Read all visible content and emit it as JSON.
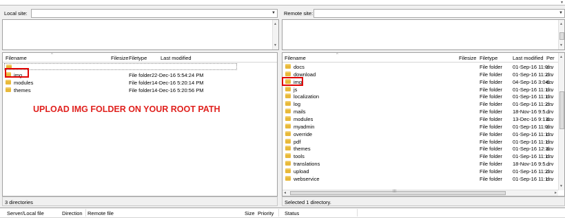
{
  "local": {
    "site_label": "Local site:",
    "headers": {
      "name": "Filename",
      "size": "Filesize",
      "type": "Filetype",
      "modified": "Last modified"
    },
    "rows": [
      {
        "name": "..",
        "type": "",
        "modified": ""
      },
      {
        "name": "img",
        "type": "File folder",
        "modified": "22-Dec-16 5:54:24 PM"
      },
      {
        "name": "modules",
        "type": "File folder",
        "modified": "14-Dec-16 5:20:14 PM"
      },
      {
        "name": "themes",
        "type": "File folder",
        "modified": "14-Dec-16 5:20:56 PM"
      }
    ],
    "status": "3 directories"
  },
  "remote": {
    "site_label": "Remote site:",
    "headers": {
      "name": "Filename",
      "size": "Filesize",
      "type": "Filetype",
      "modified": "Last modified",
      "perm": "Per"
    },
    "rows": [
      {
        "name": "docs",
        "type": "File folder",
        "modified": "01-Sep-16 11:0...",
        "perm": "drv"
      },
      {
        "name": "download",
        "type": "File folder",
        "modified": "01-Sep-16 11:2...",
        "perm": "drv"
      },
      {
        "name": "img",
        "type": "File folder",
        "modified": "04-Sep-16 3:04...",
        "perm": "drv"
      },
      {
        "name": "js",
        "type": "File folder",
        "modified": "01-Sep-16 11:1...",
        "perm": "drv"
      },
      {
        "name": "localization",
        "type": "File folder",
        "modified": "01-Sep-16 11:1...",
        "perm": "drv"
      },
      {
        "name": "log",
        "type": "File folder",
        "modified": "01-Sep-16 11:2...",
        "perm": "drv"
      },
      {
        "name": "mails",
        "type": "File folder",
        "modified": "18-Nov-16 9:5...",
        "perm": "drv"
      },
      {
        "name": "modules",
        "type": "File folder",
        "modified": "13-Dec-16 9:13...",
        "perm": "drv"
      },
      {
        "name": "myadmin",
        "type": "File folder",
        "modified": "01-Sep-16 11:0...",
        "perm": "drv"
      },
      {
        "name": "override",
        "type": "File folder",
        "modified": "01-Sep-16 11:1...",
        "perm": "drv"
      },
      {
        "name": "pdf",
        "type": "File folder",
        "modified": "01-Sep-16 11:1...",
        "perm": "drv"
      },
      {
        "name": "themes",
        "type": "File folder",
        "modified": "01-Sep-16 12:3...",
        "perm": "drv"
      },
      {
        "name": "tools",
        "type": "File folder",
        "modified": "01-Sep-16 11:1...",
        "perm": "drv"
      },
      {
        "name": "translations",
        "type": "File folder",
        "modified": "18-Nov-16 9:5...",
        "perm": "drv"
      },
      {
        "name": "upload",
        "type": "File folder",
        "modified": "01-Sep-16 11:2...",
        "perm": "drv"
      },
      {
        "name": "webservice",
        "type": "File folder",
        "modified": "01-Sep-16 11:1...",
        "perm": "drv"
      }
    ],
    "status": "Selected 1 directory.",
    "hscroll_mark": "III"
  },
  "annotation": "UPLOAD IMG FOLDER ON YOUR ROOT PATH",
  "queue": {
    "headers": {
      "server": "Server/Local file",
      "direction": "Direction",
      "remote": "Remote file",
      "size": "Size",
      "priority": "Priority",
      "status": "Status"
    }
  },
  "colors": {
    "highlight": "#e00000",
    "annotation": "#e0201d",
    "folder": "#e8b93a"
  },
  "icons": [
    "folder-icon",
    "dropdown-arrow-icon",
    "scroll-up-icon",
    "scroll-down-icon",
    "scroll-left-icon",
    "scroll-right-icon"
  ]
}
